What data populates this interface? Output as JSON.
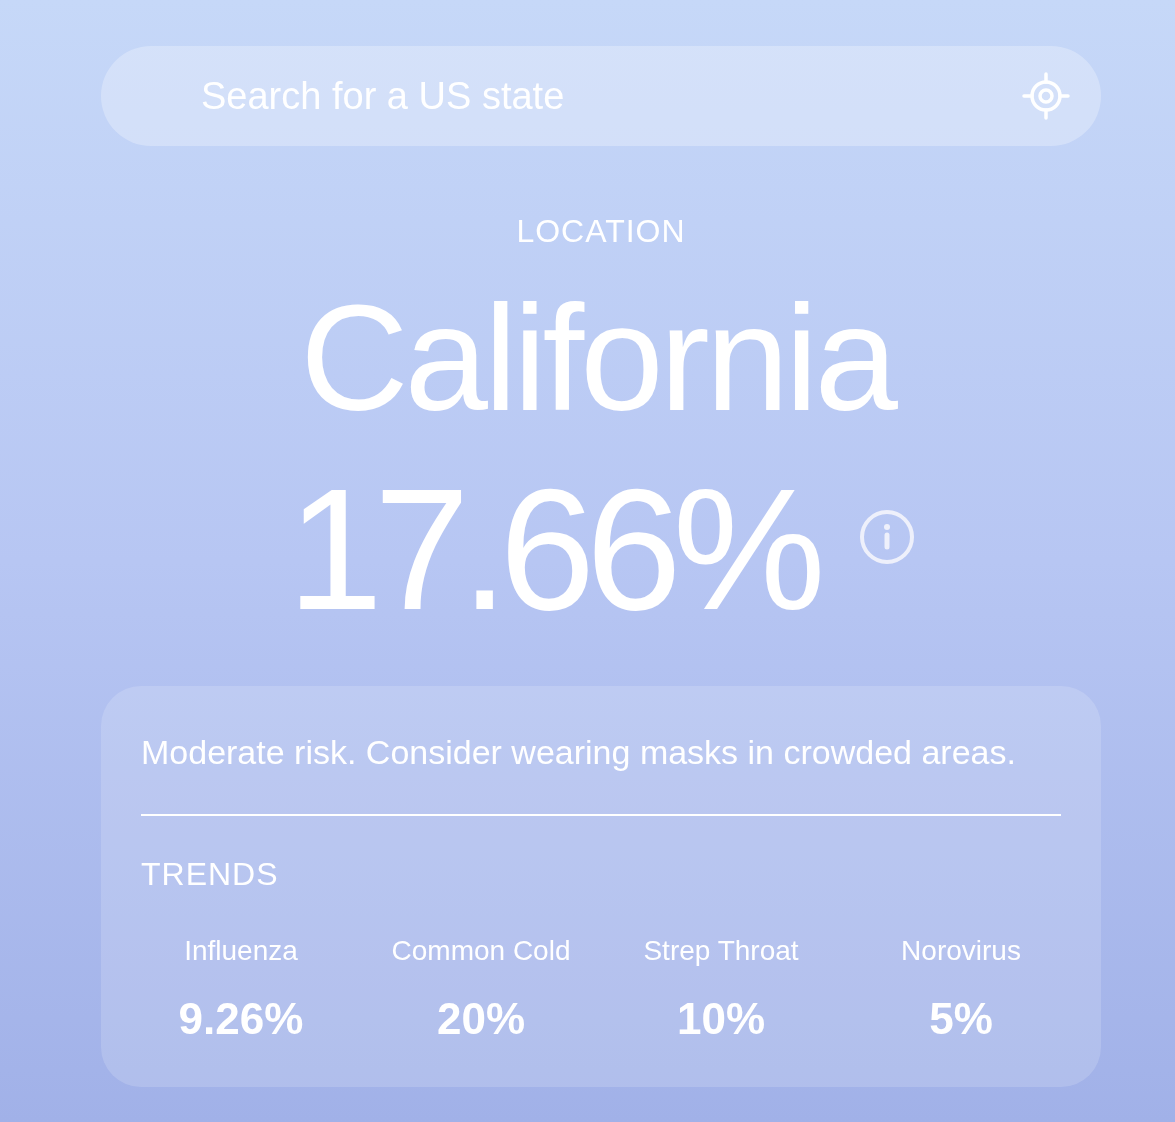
{
  "search": {
    "placeholder": "Search for a US state"
  },
  "location": {
    "label": "LOCATION",
    "name": "California",
    "rate": "17.66%"
  },
  "advice": {
    "message": "Moderate risk. Consider wearing masks in crowded areas.",
    "trends_heading": "TRENDS",
    "trends": [
      {
        "name": "Influenza",
        "value": "9.26%"
      },
      {
        "name": "Common Cold",
        "value": "20%"
      },
      {
        "name": "Strep Throat",
        "value": "10%"
      },
      {
        "name": "Norovirus",
        "value": "5%"
      }
    ]
  }
}
